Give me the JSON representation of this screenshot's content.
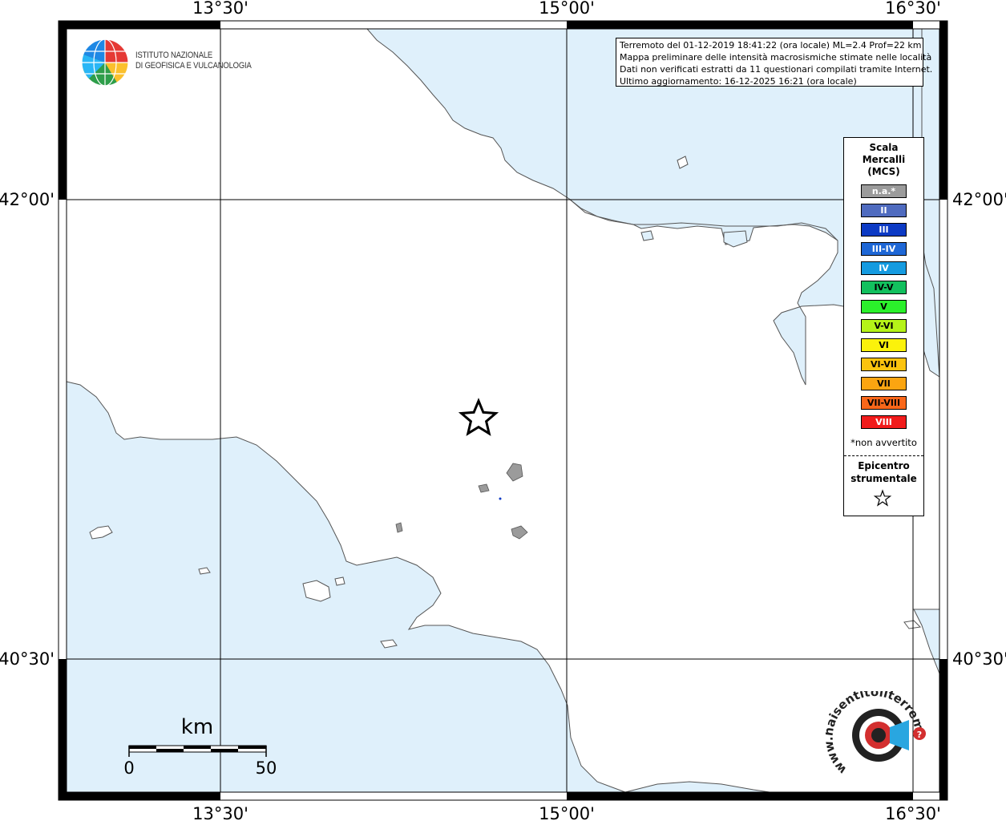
{
  "map": {
    "lon_labels": [
      "13°30'",
      "15°00'",
      "16°30'"
    ],
    "lat_labels": [
      "42°00'",
      "40°30'"
    ],
    "colors": {
      "sea": "#dff0fb",
      "land": "#ffffff",
      "coast": "#555555",
      "grid": "#000000"
    }
  },
  "info": {
    "line1": "Terremoto del 01-12-2019 18:41:22 (ora locale) ML=2.4 Prof=22 km",
    "line2": "Mappa preliminare delle intensità macrosismiche stimate nelle località",
    "line3": "Dati non verificati estratti da 11 questionari compilati tramite Internet.",
    "line4": "Ultimo aggiornamento: 16-12-2025 16:21 (ora locale)"
  },
  "legend": {
    "title_line1": "Scala",
    "title_line2": "Mercalli",
    "title_line3": "(MCS)",
    "items": [
      {
        "label": "n.a.*",
        "color": "#9b9b9b",
        "text_color": "#ffffff"
      },
      {
        "label": "II",
        "color": "#4f6bbf",
        "text_color": "#ffffff"
      },
      {
        "label": "III",
        "color": "#0c3ac4",
        "text_color": "#ffffff"
      },
      {
        "label": "III-IV",
        "color": "#1e67d6",
        "text_color": "#ffffff"
      },
      {
        "label": "IV",
        "color": "#159be0",
        "text_color": "#ffffff"
      },
      {
        "label": "IV-V",
        "color": "#12c05e",
        "text_color": "#000000"
      },
      {
        "label": "V",
        "color": "#2bf02b",
        "text_color": "#000000"
      },
      {
        "label": "V-VI",
        "color": "#b5f318",
        "text_color": "#000000"
      },
      {
        "label": "VI",
        "color": "#fbf20b",
        "text_color": "#000000"
      },
      {
        "label": "VI-VII",
        "color": "#fbc30e",
        "text_color": "#000000"
      },
      {
        "label": "VII",
        "color": "#fba511",
        "text_color": "#000000"
      },
      {
        "label": "VII-VIII",
        "color": "#f9671a",
        "text_color": "#000000"
      },
      {
        "label": "VIII",
        "color": "#f11b1b",
        "text_color": "#ffffff"
      }
    ],
    "note": "*non avvertito",
    "epicenter_line1": "Epicentro",
    "epicenter_line2": "strumentale"
  },
  "scale_bar": {
    "unit": "km",
    "start": "0",
    "end": "50"
  },
  "logos": {
    "ingv_line1": "ISTITUTO NAZIONALE",
    "ingv_line2": "DI GEOFISICA E VULCANOLOGIA",
    "hsit_text": "www.haisentitoilterremoto.it"
  }
}
